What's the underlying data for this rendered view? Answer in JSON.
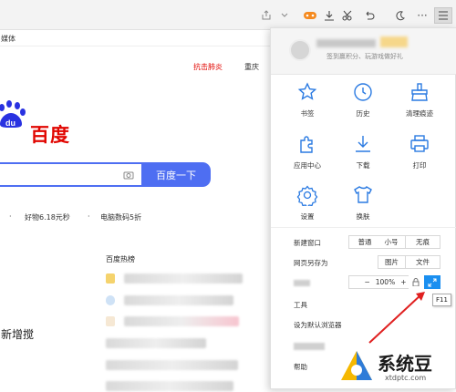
{
  "bookmarks_bar": {
    "item": "媒体"
  },
  "page": {
    "logo_text": "百度",
    "search_button": "百度一下",
    "red_link": "抗击肺炎",
    "city": "重庆",
    "hot_links": [
      "好物6.18元秒",
      "电脑数码5折"
    ],
    "hot_title": "百度热榜",
    "new_feature": "新增搅"
  },
  "menu": {
    "user_subtitle": "签到赢积分、玩游戏做好礼",
    "grid": [
      {
        "label": "书签",
        "icon": "star-icon"
      },
      {
        "label": "历史",
        "icon": "clock-icon"
      },
      {
        "label": "清理痕迹",
        "icon": "broom-icon"
      },
      {
        "label": "应用中心",
        "icon": "puzzle-icon"
      },
      {
        "label": "下载",
        "icon": "download-icon"
      },
      {
        "label": "打印",
        "icon": "printer-icon"
      },
      {
        "label": "设置",
        "icon": "gear-icon"
      },
      {
        "label": "换肤",
        "icon": "shirt-icon"
      }
    ],
    "new_window": {
      "label": "新建窗口",
      "options": [
        "普通",
        "小号",
        "无痕"
      ]
    },
    "save_page": {
      "label": "网页另存为",
      "options": [
        "图片",
        "文件"
      ]
    },
    "zoom": {
      "value": "100%",
      "minus": "−",
      "plus": "+"
    },
    "tools": "工具",
    "set_default": "设为默认浏览器",
    "help": "帮助",
    "f11_tooltip": "F11"
  },
  "watermark": {
    "text": "系统豆",
    "url": "xtdptc.com"
  },
  "colors": {
    "accent": "#2a7ae2",
    "baidu_red": "#e10601",
    "baidu_blue": "#4e6ef2",
    "fullscreen_btn": "#1a8ff0"
  }
}
